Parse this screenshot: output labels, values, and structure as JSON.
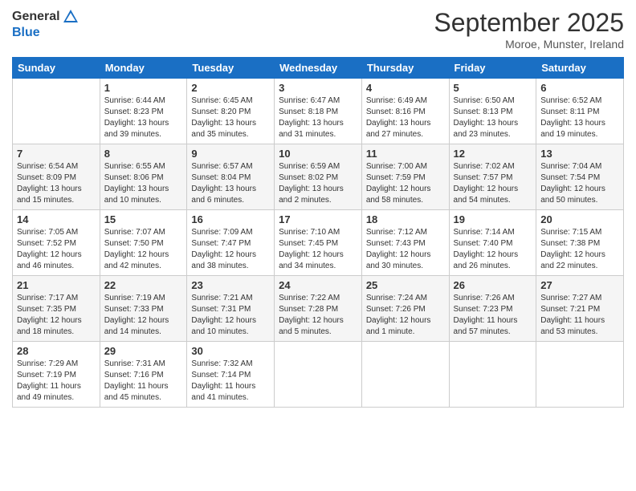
{
  "header": {
    "logo_general": "General",
    "logo_blue": "Blue",
    "month": "September 2025",
    "location": "Moroe, Munster, Ireland"
  },
  "days_of_week": [
    "Sunday",
    "Monday",
    "Tuesday",
    "Wednesday",
    "Thursday",
    "Friday",
    "Saturday"
  ],
  "weeks": [
    [
      {
        "day": "",
        "info": ""
      },
      {
        "day": "1",
        "info": "Sunrise: 6:44 AM\nSunset: 8:23 PM\nDaylight: 13 hours\nand 39 minutes."
      },
      {
        "day": "2",
        "info": "Sunrise: 6:45 AM\nSunset: 8:20 PM\nDaylight: 13 hours\nand 35 minutes."
      },
      {
        "day": "3",
        "info": "Sunrise: 6:47 AM\nSunset: 8:18 PM\nDaylight: 13 hours\nand 31 minutes."
      },
      {
        "day": "4",
        "info": "Sunrise: 6:49 AM\nSunset: 8:16 PM\nDaylight: 13 hours\nand 27 minutes."
      },
      {
        "day": "5",
        "info": "Sunrise: 6:50 AM\nSunset: 8:13 PM\nDaylight: 13 hours\nand 23 minutes."
      },
      {
        "day": "6",
        "info": "Sunrise: 6:52 AM\nSunset: 8:11 PM\nDaylight: 13 hours\nand 19 minutes."
      }
    ],
    [
      {
        "day": "7",
        "info": "Sunrise: 6:54 AM\nSunset: 8:09 PM\nDaylight: 13 hours\nand 15 minutes."
      },
      {
        "day": "8",
        "info": "Sunrise: 6:55 AM\nSunset: 8:06 PM\nDaylight: 13 hours\nand 10 minutes."
      },
      {
        "day": "9",
        "info": "Sunrise: 6:57 AM\nSunset: 8:04 PM\nDaylight: 13 hours\nand 6 minutes."
      },
      {
        "day": "10",
        "info": "Sunrise: 6:59 AM\nSunset: 8:02 PM\nDaylight: 13 hours\nand 2 minutes."
      },
      {
        "day": "11",
        "info": "Sunrise: 7:00 AM\nSunset: 7:59 PM\nDaylight: 12 hours\nand 58 minutes."
      },
      {
        "day": "12",
        "info": "Sunrise: 7:02 AM\nSunset: 7:57 PM\nDaylight: 12 hours\nand 54 minutes."
      },
      {
        "day": "13",
        "info": "Sunrise: 7:04 AM\nSunset: 7:54 PM\nDaylight: 12 hours\nand 50 minutes."
      }
    ],
    [
      {
        "day": "14",
        "info": "Sunrise: 7:05 AM\nSunset: 7:52 PM\nDaylight: 12 hours\nand 46 minutes."
      },
      {
        "day": "15",
        "info": "Sunrise: 7:07 AM\nSunset: 7:50 PM\nDaylight: 12 hours\nand 42 minutes."
      },
      {
        "day": "16",
        "info": "Sunrise: 7:09 AM\nSunset: 7:47 PM\nDaylight: 12 hours\nand 38 minutes."
      },
      {
        "day": "17",
        "info": "Sunrise: 7:10 AM\nSunset: 7:45 PM\nDaylight: 12 hours\nand 34 minutes."
      },
      {
        "day": "18",
        "info": "Sunrise: 7:12 AM\nSunset: 7:43 PM\nDaylight: 12 hours\nand 30 minutes."
      },
      {
        "day": "19",
        "info": "Sunrise: 7:14 AM\nSunset: 7:40 PM\nDaylight: 12 hours\nand 26 minutes."
      },
      {
        "day": "20",
        "info": "Sunrise: 7:15 AM\nSunset: 7:38 PM\nDaylight: 12 hours\nand 22 minutes."
      }
    ],
    [
      {
        "day": "21",
        "info": "Sunrise: 7:17 AM\nSunset: 7:35 PM\nDaylight: 12 hours\nand 18 minutes."
      },
      {
        "day": "22",
        "info": "Sunrise: 7:19 AM\nSunset: 7:33 PM\nDaylight: 12 hours\nand 14 minutes."
      },
      {
        "day": "23",
        "info": "Sunrise: 7:21 AM\nSunset: 7:31 PM\nDaylight: 12 hours\nand 10 minutes."
      },
      {
        "day": "24",
        "info": "Sunrise: 7:22 AM\nSunset: 7:28 PM\nDaylight: 12 hours\nand 5 minutes."
      },
      {
        "day": "25",
        "info": "Sunrise: 7:24 AM\nSunset: 7:26 PM\nDaylight: 12 hours\nand 1 minute."
      },
      {
        "day": "26",
        "info": "Sunrise: 7:26 AM\nSunset: 7:23 PM\nDaylight: 11 hours\nand 57 minutes."
      },
      {
        "day": "27",
        "info": "Sunrise: 7:27 AM\nSunset: 7:21 PM\nDaylight: 11 hours\nand 53 minutes."
      }
    ],
    [
      {
        "day": "28",
        "info": "Sunrise: 7:29 AM\nSunset: 7:19 PM\nDaylight: 11 hours\nand 49 minutes."
      },
      {
        "day": "29",
        "info": "Sunrise: 7:31 AM\nSunset: 7:16 PM\nDaylight: 11 hours\nand 45 minutes."
      },
      {
        "day": "30",
        "info": "Sunrise: 7:32 AM\nSunset: 7:14 PM\nDaylight: 11 hours\nand 41 minutes."
      },
      {
        "day": "",
        "info": ""
      },
      {
        "day": "",
        "info": ""
      },
      {
        "day": "",
        "info": ""
      },
      {
        "day": "",
        "info": ""
      }
    ]
  ]
}
